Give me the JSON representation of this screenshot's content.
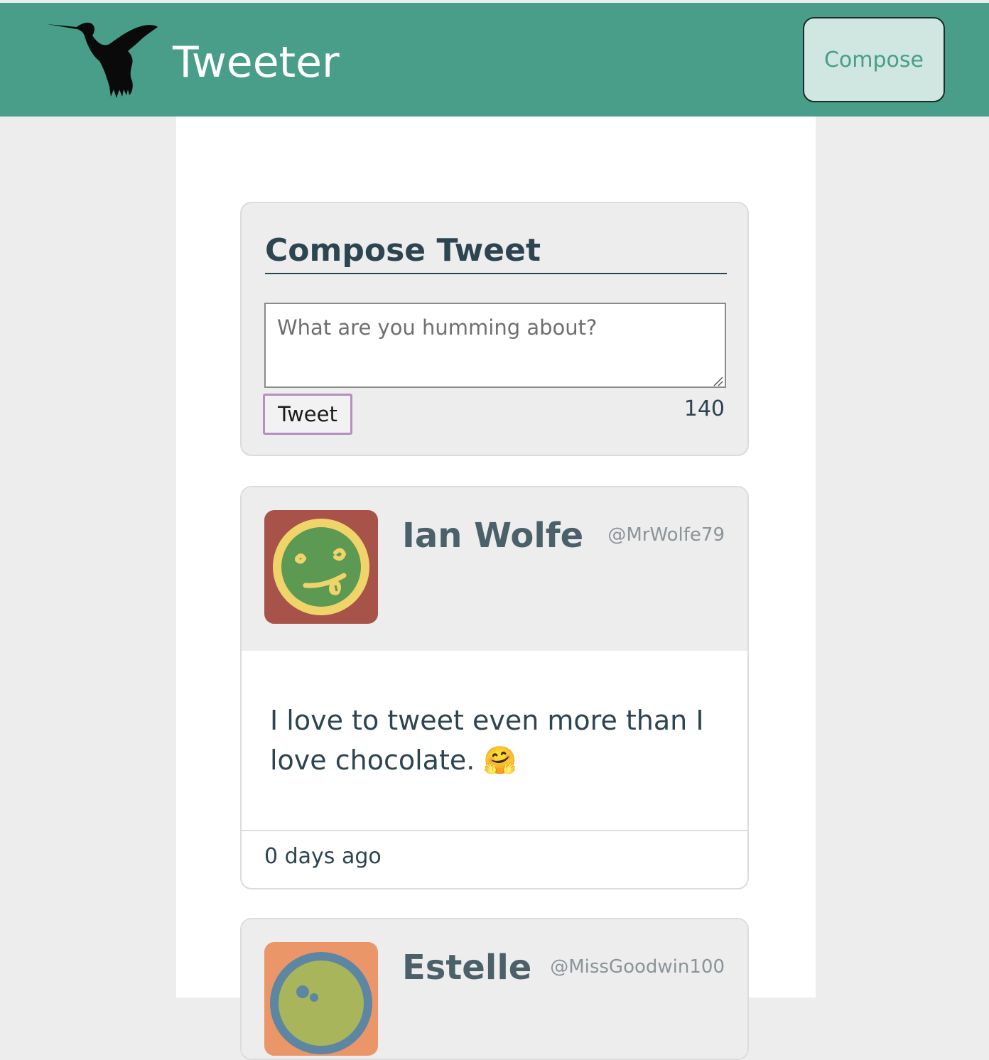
{
  "header": {
    "brand": "Tweeter",
    "compose_label": "Compose"
  },
  "compose": {
    "title": "Compose Tweet",
    "placeholder": "What are you humming about?",
    "submit_label": "Tweet",
    "char_count": "140"
  },
  "tweets": [
    {
      "name": "Ian Wolfe",
      "handle": "@MrWolfe79",
      "text": "I love to tweet even more than I love chocolate. 🤗",
      "timestamp": "0 days ago"
    },
    {
      "name": "Estelle",
      "handle": "@MissGoodwin100"
    }
  ],
  "colors": {
    "nav": "#489e89",
    "compose_button_bg": "#cfe7e0",
    "text_dark": "#2d4550",
    "avatar1_bg": "#a8534a",
    "avatar1_face": "#5c9a53",
    "avatar1_ring": "#f0d46a",
    "avatar2_bg": "#ea9669",
    "avatar2_face": "#a9b55a",
    "avatar2_ring": "#5d86a3"
  },
  "icons": {
    "logo": "hummingbird-icon",
    "avatar1": "tongue-out-face-avatar",
    "avatar2": "face-avatar"
  }
}
